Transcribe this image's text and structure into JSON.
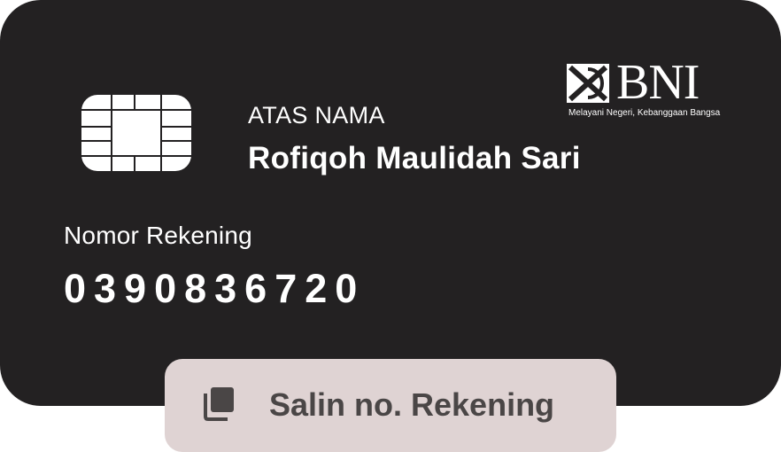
{
  "colors": {
    "card_bg": "#232122",
    "text_on_card": "#ffffff",
    "button_bg": "#dfd3d3",
    "button_text": "#4a4646"
  },
  "card": {
    "chip_icon": "sim-chip-icon",
    "bank": {
      "logo_icon": "bni-logo-icon",
      "name": "BNI",
      "tagline": "Melayani Negeri, Kebanggaan Bangsa"
    },
    "owner_label": "ATAS NAMA",
    "owner_name": "Rofiqoh Maulidah Sari",
    "account_label": "Nomor Rekening",
    "account_number": "0390836720"
  },
  "copy_button": {
    "icon": "copy-icon",
    "label": "Salin no. Rekening"
  }
}
